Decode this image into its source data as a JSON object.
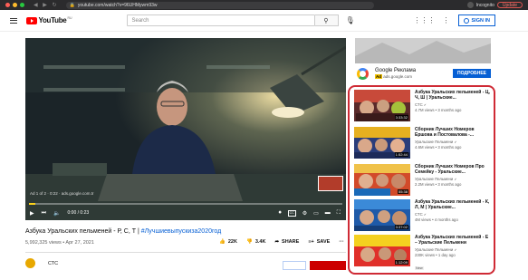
{
  "browser": {
    "url": "youtube.com/watch?v=96UHMywm93w",
    "incognito_label": "Incognito",
    "update_label": "Update"
  },
  "header": {
    "logo_text": "YouTube",
    "logo_region": "RU",
    "search_placeholder": "Search",
    "signin_label": "SIGN IN"
  },
  "player": {
    "ad_label": "Ad 1 of 2 · 0:22 · ads.google.com.tr",
    "time": "0:00 / 0:23",
    "progress_fraction": 0.02
  },
  "video": {
    "title_main": "Азбука Уральских пельменей - Р, С, Т |",
    "title_hashtag": "#Лучшиевыпускиза2020год",
    "meta": "5,992,325 views • Apr 27, 2021",
    "likes": "22K",
    "dislikes": "3.4K",
    "share_label": "SHARE",
    "save_label": "SAVE",
    "channel": "СТС"
  },
  "ad": {
    "title": "Google Реклама",
    "ad_tag": "Ad",
    "domain": "ads.google.com",
    "more_label": "ПОДРОБНЕЕ"
  },
  "recs": [
    {
      "title": "Азбука Уральских пельменей - Ц, Ч, Ш | Уральские...",
      "channel": "СТС",
      "views": "4.7M views • 3 months ago",
      "duration": "3:33:32"
    },
    {
      "title": "Сборник Лучших Номеров Ершова и Постовалова -...",
      "channel": "Уральские Пельмени",
      "views": "4.6M views • 3 months ago",
      "duration": "1:52:44"
    },
    {
      "title": "Сборник Лучших Номеров Про Семейку - Уральские...",
      "channel": "Уральские Пельмени",
      "views": "2.2M views • 3 months ago",
      "duration": "55:38"
    },
    {
      "title": "Азбука Уральских пельменей - К, Л, М | Уральские...",
      "channel": "СТС",
      "views": "4M views • 4 months ago",
      "duration": "3:37:02"
    },
    {
      "title": "Азбука Уральских пельменей - Е – Уральские Пельмени",
      "channel": "Уральские Пельмени",
      "views": "230K views • 1 day ago",
      "duration": "1:12:09",
      "badge": "New"
    }
  ]
}
